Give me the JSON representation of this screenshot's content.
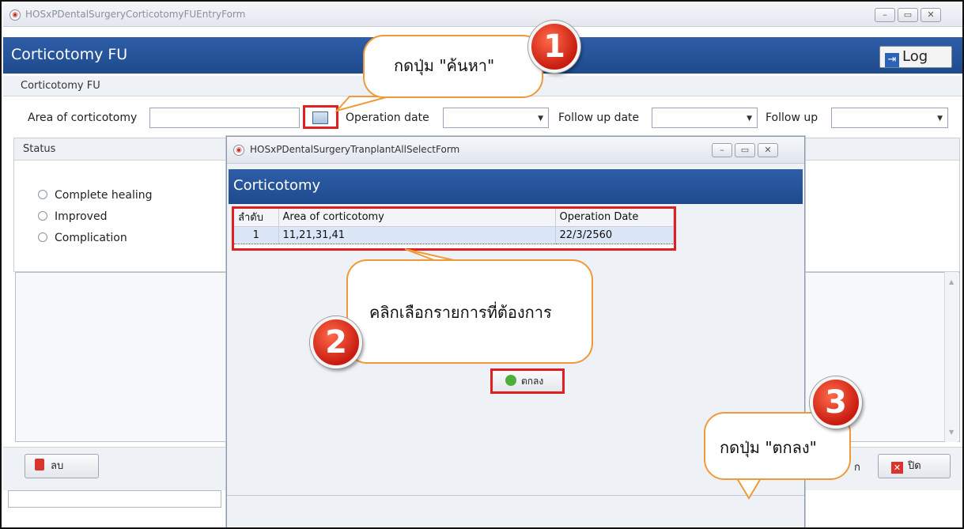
{
  "main_window": {
    "title": "HOSxPDentalSurgeryCorticotomyFUEntryForm",
    "header_title": "Corticotomy FU",
    "log_button": "Log",
    "section_label": "Corticotomy FU",
    "fields": {
      "area_label": "Area of corticotomy",
      "area_value": "",
      "operation_date_label": "Operation date",
      "operation_date_value": "",
      "follow_up_date_label": "Follow up date",
      "follow_up_date_value": "",
      "follow_up_label": "Follow up",
      "follow_up_value": ""
    },
    "status": {
      "label": "Status",
      "options": [
        "Complete healing",
        "Improved",
        "Complication"
      ]
    },
    "delete_button": "ลบ",
    "close_button": "ปิด",
    "partial_text": "ก"
  },
  "dialog": {
    "title": "HOSxPDentalSurgeryTranplantAllSelectForm",
    "header_title": "Corticotomy",
    "columns": [
      "ลำดับ",
      "Area of corticotomy",
      "Operation Date"
    ],
    "rows": [
      [
        "1",
        "11,21,31,41",
        "22/3/2560"
      ]
    ],
    "ok_button": "ตกลง"
  },
  "callouts": {
    "step1": {
      "number": "1",
      "text": "กดปุ่ม \"ค้นหา\""
    },
    "step2": {
      "number": "2",
      "text": "คลิกเลือกรายการที่ต้องการ"
    },
    "step3": {
      "number": "3",
      "text": "กดปุ่ม \"ตกลง\""
    }
  },
  "colors": {
    "header_blue": "#1e4a8d",
    "highlight_red": "#e02020",
    "callout_border": "#ef9a3a",
    "badge_red": "#c81c10"
  }
}
